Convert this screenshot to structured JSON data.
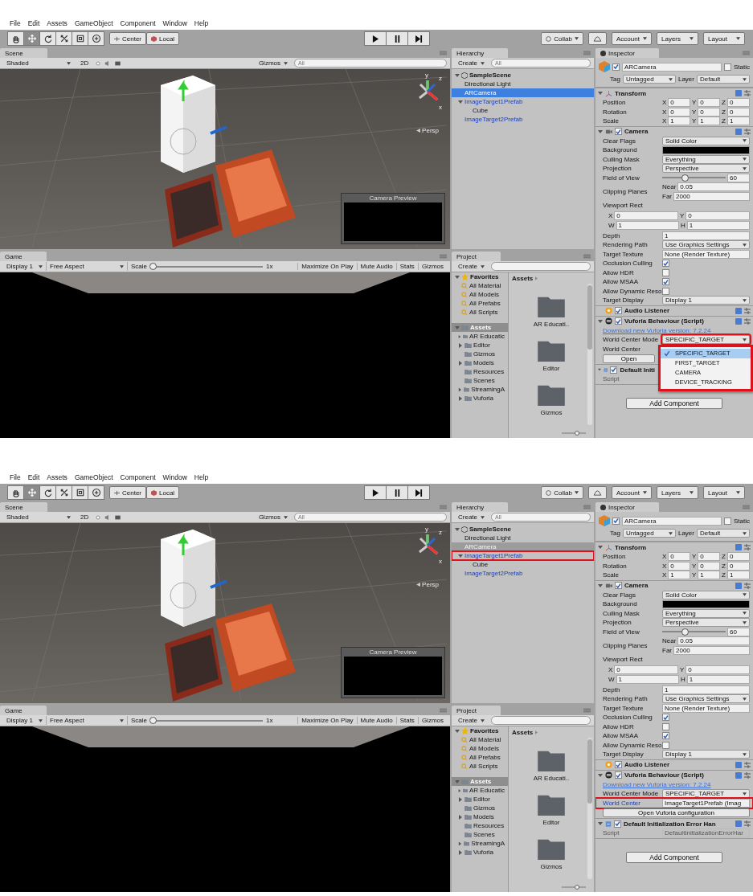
{
  "screenshots": [
    {
      "menu": [
        "File",
        "Edit",
        "Assets",
        "GameObject",
        "Component",
        "Window",
        "Help"
      ],
      "toolbar": {
        "tools": [
          {
            "kind": "hand",
            "selected": false
          },
          {
            "kind": "move",
            "selected": true
          },
          {
            "kind": "rotate",
            "selected": false
          },
          {
            "kind": "scale",
            "selected": false
          },
          {
            "kind": "rect",
            "selected": false
          },
          {
            "kind": "transform",
            "selected": false
          }
        ],
        "pivot": "Center",
        "space": "Local",
        "collab": "Collab",
        "account": "Account",
        "layers": "Layers",
        "layout": "Layout"
      },
      "scene": {
        "tab": "Scene",
        "shading": "Shaded",
        "mode_2d": "2D",
        "gizmos": "Gizmos",
        "search_placeholder": "All",
        "axis_labels": [
          "y",
          "z",
          "x"
        ],
        "projection": "Persp",
        "camera_preview": "Camera Preview"
      },
      "game": {
        "tab": "Game",
        "display": "Display 1",
        "aspect": "Free Aspect",
        "scale_label": "Scale",
        "scale": {
          "level": 0.02,
          "value": "1x"
        },
        "buttons": [
          "Maximize On Play",
          "Mute Audio",
          "Stats",
          "Gizmos"
        ]
      },
      "hierarchy": {
        "tab": "Hierarchy",
        "create": "Create",
        "search_placeholder": "All",
        "scene": "SampleScene",
        "items": [
          {
            "label": "Directional Light",
            "kind": "object",
            "selected": false,
            "dimmed": false,
            "highlighted": false
          },
          {
            "label": "ARCamera",
            "kind": "object",
            "selected": true,
            "dimmed": false,
            "highlighted": false
          },
          {
            "label": "ImageTarget1Prefab",
            "kind": "prefab",
            "selected": false,
            "dimmed": false,
            "highlighted": false,
            "children": [
              {
                "label": "Cube",
                "kind": "object",
                "selected": false,
                "dimmed": false,
                "highlighted": false
              }
            ]
          },
          {
            "label": "ImageTarget2Prefab",
            "kind": "prefab",
            "selected": false,
            "dimmed": false,
            "highlighted": false
          }
        ]
      },
      "project": {
        "tab": "Project",
        "create": "Create",
        "favorites": "Favorites",
        "favorite_items": [
          "All Material",
          "All Models",
          "All Prefabs",
          "All Scripts"
        ],
        "assets": "Assets",
        "asset_items": [
          {
            "label": "AR Educatic",
            "has_children": true
          },
          {
            "label": "Editor",
            "has_children": true
          },
          {
            "label": "Gizmos",
            "has_children": false
          },
          {
            "label": "Models",
            "has_children": true
          },
          {
            "label": "Resources",
            "has_children": false
          },
          {
            "label": "Scenes",
            "has_children": false
          },
          {
            "label": "StreamingA",
            "has_children": true
          },
          {
            "label": "Vuforia",
            "has_children": true
          }
        ],
        "breadcrumb": "Assets",
        "folders": [
          "AR Educati..",
          "Editor",
          "Gizmos"
        ]
      },
      "inspector": {
        "tab": "Inspector",
        "object": {
          "name": "ARCamera",
          "active": true,
          "static_label": "Static",
          "static": false,
          "tag_label": "Tag",
          "tag": "Untagged",
          "layer_label": "Layer",
          "layer": "Default"
        },
        "components": [
          {
            "name": "Transform",
            "kind": "transform",
            "rows": [
              {
                "kind": "vector",
                "label": "Position",
                "fields": [
                  {
                    "axis": "X",
                    "value": "0"
                  },
                  {
                    "axis": "Y",
                    "value": "0"
                  },
                  {
                    "axis": "Z",
                    "value": "0"
                  }
                ]
              },
              {
                "kind": "vector",
                "label": "Rotation",
                "fields": [
                  {
                    "axis": "X",
                    "value": "0"
                  },
                  {
                    "axis": "Y",
                    "value": "0"
                  },
                  {
                    "axis": "Z",
                    "value": "0"
                  }
                ]
              },
              {
                "kind": "vector",
                "label": "Scale",
                "fields": [
                  {
                    "axis": "X",
                    "value": "1"
                  },
                  {
                    "axis": "Y",
                    "value": "1"
                  },
                  {
                    "axis": "Z",
                    "value": "1"
                  }
                ]
              }
            ]
          },
          {
            "name": "Camera",
            "kind": "camera",
            "enabled": true,
            "rows": [
              {
                "kind": "dropdown",
                "label": "Clear Flags",
                "value": "Solid Color"
              },
              {
                "kind": "color",
                "label": "Background",
                "color": "#000000"
              },
              {
                "kind": "dropdown",
                "label": "Culling Mask",
                "value": "Everything"
              },
              {
                "kind": "dropdown",
                "label": "Projection",
                "value": "Perspective"
              },
              {
                "kind": "slider",
                "label": "Field of View",
                "level": 0.36,
                "value": "60"
              },
              {
                "kind": "fields",
                "label": "Clipping Planes",
                "lines": [
                  [
                    {
                      "axis": "Near",
                      "value": "0.05"
                    }
                  ],
                  [
                    {
                      "axis": "Far",
                      "value": "2000"
                    }
                  ]
                ]
              },
              {
                "kind": "rect",
                "label": "Viewport Rect",
                "lines": [
                  [
                    {
                      "axis": "X",
                      "value": "0"
                    },
                    {
                      "axis": "Y",
                      "value": "0"
                    }
                  ],
                  [
                    {
                      "axis": "W",
                      "value": "1"
                    },
                    {
                      "axis": "H",
                      "value": "1"
                    }
                  ]
                ]
              },
              {
                "kind": "text",
                "label": "Depth",
                "value": "1"
              },
              {
                "kind": "dropdown",
                "label": "Rendering Path",
                "value": "Use Graphics Settings"
              },
              {
                "kind": "object",
                "label": "Target Texture",
                "value": "None (Render Texture)"
              },
              {
                "kind": "checkbox",
                "label": "Occlusion Culling",
                "checked": true
              },
              {
                "kind": "checkbox",
                "label": "Allow HDR",
                "checked": false
              },
              {
                "kind": "checkbox",
                "label": "Allow MSAA",
                "checked": true
              },
              {
                "kind": "checkbox",
                "label": "Allow Dynamic Reso",
                "checked": false
              },
              {
                "kind": "dropdown",
                "label": "Target Display",
                "value": "Display 1"
              }
            ]
          },
          {
            "name": "Audio Listener",
            "kind": "audio",
            "enabled": true
          },
          {
            "name": "Vuforia Behaviour (Script)",
            "kind": "vuforia",
            "enabled": true,
            "rows": [
              {
                "kind": "link",
                "text": "Download new Vuforia version: 7.2.24"
              },
              {
                "kind": "dropdown",
                "label": "World Center Mode",
                "value": "SPECIFIC_TARGET",
                "popup": {
                  "highlighted": true,
                  "options": [
                    {
                      "label": "SPECIFIC_TARGET",
                      "selected": true
                    },
                    {
                      "label": "FIRST_TARGET",
                      "selected": false
                    },
                    {
                      "label": "CAMERA",
                      "selected": false
                    },
                    {
                      "label": "DEVICE_TRACKING",
                      "selected": false
                    }
                  ]
                }
              },
              {
                "kind": "object",
                "label": "World Center",
                "highlighted": false,
                "modified": false
              },
              {
                "kind": "button",
                "label": "Open"
              }
            ]
          },
          {
            "name": "Default Initi",
            "kind": "script",
            "enabled": true,
            "rows": [
              {
                "kind": "script",
                "label": "Script"
              }
            ]
          }
        ],
        "add_component": "Add Component"
      }
    },
    {
      "menu": [
        "File",
        "Edit",
        "Assets",
        "GameObject",
        "Component",
        "Window",
        "Help"
      ],
      "toolbar": {
        "tools": [
          {
            "kind": "hand",
            "selected": false
          },
          {
            "kind": "move",
            "selected": true
          },
          {
            "kind": "rotate",
            "selected": false
          },
          {
            "kind": "scale",
            "selected": false
          },
          {
            "kind": "rect",
            "selected": false
          },
          {
            "kind": "transform",
            "selected": false
          }
        ],
        "pivot": "Center",
        "space": "Local",
        "collab": "Collab",
        "account": "Account",
        "layers": "Layers",
        "layout": "Layout"
      },
      "scene": {
        "tab": "Scene",
        "shading": "Shaded",
        "mode_2d": "2D",
        "gizmos": "Gizmos",
        "search_placeholder": "All",
        "axis_labels": [
          "y",
          "z",
          "x"
        ],
        "projection": "Persp",
        "camera_preview": "Camera Preview"
      },
      "game": {
        "tab": "Game",
        "display": "Display 1",
        "aspect": "Free Aspect",
        "scale_label": "Scale",
        "scale": {
          "level": 0.02,
          "value": "1x"
        },
        "buttons": [
          "Maximize On Play",
          "Mute Audio",
          "Stats",
          "Gizmos"
        ]
      },
      "hierarchy": {
        "tab": "Hierarchy",
        "create": "Create",
        "search_placeholder": "All",
        "scene": "SampleScene",
        "items": [
          {
            "label": "Directional Light",
            "kind": "object",
            "selected": false,
            "dimmed": false,
            "highlighted": false
          },
          {
            "label": "ARCamera",
            "kind": "object",
            "selected": false,
            "dimmed": true,
            "highlighted": false
          },
          {
            "label": "ImageTarget1Prefab",
            "kind": "prefab",
            "selected": false,
            "dimmed": false,
            "highlighted": true,
            "children": [
              {
                "label": "Cube",
                "kind": "object",
                "selected": false,
                "dimmed": false,
                "highlighted": false
              }
            ]
          },
          {
            "label": "ImageTarget2Prefab",
            "kind": "prefab",
            "selected": false,
            "dimmed": false,
            "highlighted": false
          }
        ]
      },
      "project": {
        "tab": "Project",
        "create": "Create",
        "favorites": "Favorites",
        "favorite_items": [
          "All Material",
          "All Models",
          "All Prefabs",
          "All Scripts"
        ],
        "assets": "Assets",
        "asset_items": [
          {
            "label": "AR Educatic",
            "has_children": true
          },
          {
            "label": "Editor",
            "has_children": true
          },
          {
            "label": "Gizmos",
            "has_children": false
          },
          {
            "label": "Models",
            "has_children": true
          },
          {
            "label": "Resources",
            "has_children": false
          },
          {
            "label": "Scenes",
            "has_children": false
          },
          {
            "label": "StreamingA",
            "has_children": true
          },
          {
            "label": "Vuforia",
            "has_children": true
          }
        ],
        "breadcrumb": "Assets",
        "folders": [
          "AR Educati..",
          "Editor",
          "Gizmos"
        ]
      },
      "inspector": {
        "tab": "Inspector",
        "object": {
          "name": "ARCamera",
          "active": true,
          "static_label": "Static",
          "static": false,
          "tag_label": "Tag",
          "tag": "Untagged",
          "layer_label": "Layer",
          "layer": "Default"
        },
        "components": [
          {
            "name": "Transform",
            "kind": "transform",
            "rows": [
              {
                "kind": "vector",
                "label": "Position",
                "fields": [
                  {
                    "axis": "X",
                    "value": "0"
                  },
                  {
                    "axis": "Y",
                    "value": "0"
                  },
                  {
                    "axis": "Z",
                    "value": "0"
                  }
                ]
              },
              {
                "kind": "vector",
                "label": "Rotation",
                "fields": [
                  {
                    "axis": "X",
                    "value": "0"
                  },
                  {
                    "axis": "Y",
                    "value": "0"
                  },
                  {
                    "axis": "Z",
                    "value": "0"
                  }
                ]
              },
              {
                "kind": "vector",
                "label": "Scale",
                "fields": [
                  {
                    "axis": "X",
                    "value": "1"
                  },
                  {
                    "axis": "Y",
                    "value": "1"
                  },
                  {
                    "axis": "Z",
                    "value": "1"
                  }
                ]
              }
            ]
          },
          {
            "name": "Camera",
            "kind": "camera",
            "enabled": true,
            "rows": [
              {
                "kind": "dropdown",
                "label": "Clear Flags",
                "value": "Solid Color"
              },
              {
                "kind": "color",
                "label": "Background",
                "color": "#000000"
              },
              {
                "kind": "dropdown",
                "label": "Culling Mask",
                "value": "Everything"
              },
              {
                "kind": "dropdown",
                "label": "Projection",
                "value": "Perspective"
              },
              {
                "kind": "slider",
                "label": "Field of View",
                "level": 0.36,
                "value": "60"
              },
              {
                "kind": "fields",
                "label": "Clipping Planes",
                "lines": [
                  [
                    {
                      "axis": "Near",
                      "value": "0.05"
                    }
                  ],
                  [
                    {
                      "axis": "Far",
                      "value": "2000"
                    }
                  ]
                ]
              },
              {
                "kind": "rect",
                "label": "Viewport Rect",
                "lines": [
                  [
                    {
                      "axis": "X",
                      "value": "0"
                    },
                    {
                      "axis": "Y",
                      "value": "0"
                    }
                  ],
                  [
                    {
                      "axis": "W",
                      "value": "1"
                    },
                    {
                      "axis": "H",
                      "value": "1"
                    }
                  ]
                ]
              },
              {
                "kind": "text",
                "label": "Depth",
                "value": "1"
              },
              {
                "kind": "dropdown",
                "label": "Rendering Path",
                "value": "Use Graphics Settings"
              },
              {
                "kind": "object",
                "label": "Target Texture",
                "value": "None (Render Texture)"
              },
              {
                "kind": "checkbox",
                "label": "Occlusion Culling",
                "checked": true
              },
              {
                "kind": "checkbox",
                "label": "Allow HDR",
                "checked": false
              },
              {
                "kind": "checkbox",
                "label": "Allow MSAA",
                "checked": true
              },
              {
                "kind": "checkbox",
                "label": "Allow Dynamic Reso",
                "checked": false
              },
              {
                "kind": "dropdown",
                "label": "Target Display",
                "value": "Display 1"
              }
            ]
          },
          {
            "name": "Audio Listener",
            "kind": "audio",
            "enabled": true
          },
          {
            "name": "Vuforia Behaviour (Script)",
            "kind": "vuforia",
            "enabled": true,
            "rows": [
              {
                "kind": "link",
                "text": "Download new Vuforia version: 7.2.24"
              },
              {
                "kind": "dropdown",
                "label": "World Center Mode",
                "value": "SPECIFIC_TARGET"
              },
              {
                "kind": "object",
                "label": "World Center",
                "value": "ImageTarget1Prefab (Imag",
                "highlighted": true,
                "modified": true
              },
              {
                "kind": "button",
                "label": "Open Vuforia configuration"
              }
            ]
          },
          {
            "name": "Default Initialization Error Han",
            "kind": "script",
            "enabled": true,
            "rows": [
              {
                "kind": "script",
                "label": "Script",
                "value": "DefaultInitializationErrorHar"
              }
            ]
          }
        ],
        "add_component": "Add Component"
      }
    }
  ]
}
